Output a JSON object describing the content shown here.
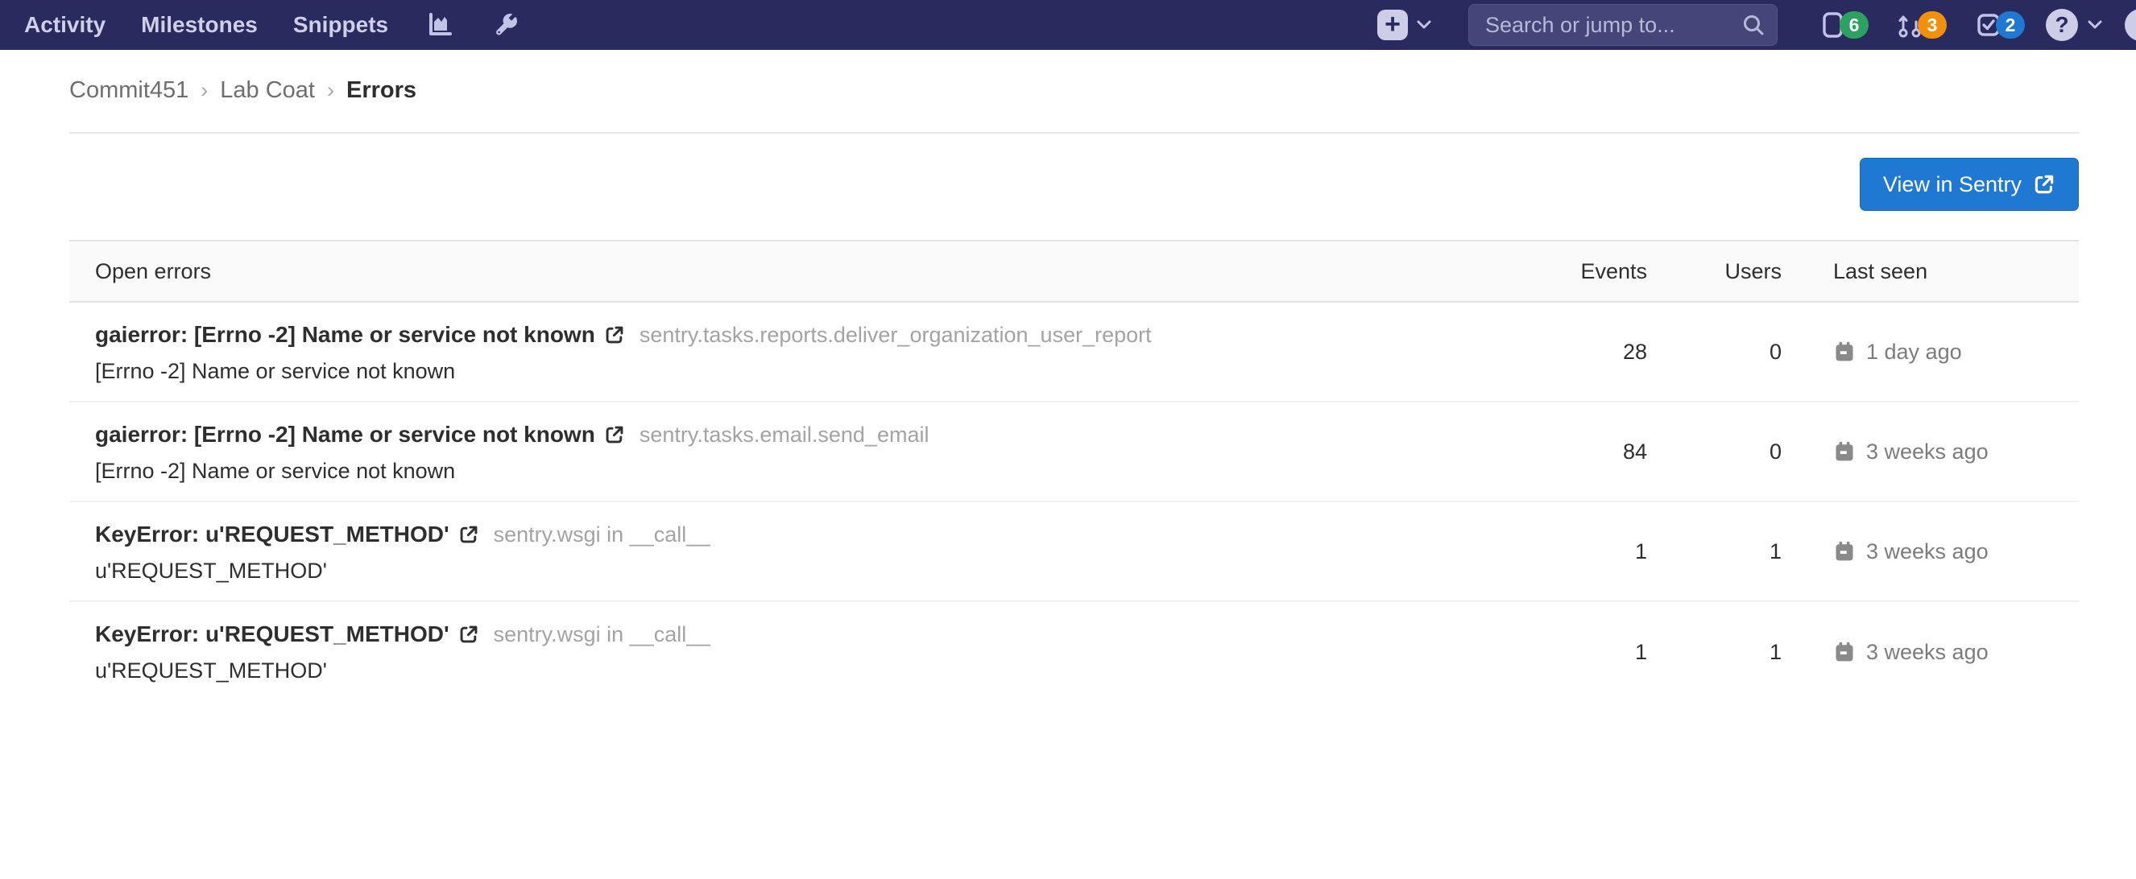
{
  "colors": {
    "navbar_bg": "#292a5e",
    "accent_blue": "#1f78d1",
    "badge_green": "#2da160",
    "badge_orange": "#f2900e",
    "badge_blue": "#1f78d1"
  },
  "navbar": {
    "links": [
      "Activity",
      "Milestones",
      "Snippets"
    ],
    "nav_icons": [
      "area-chart-icon",
      "wrench-icon"
    ],
    "plus_glyph": "+",
    "search_placeholder": "Search or jump to...",
    "counters": [
      {
        "name": "issues",
        "icon": "issues-icon",
        "count": "6",
        "color": "#2da160"
      },
      {
        "name": "merge_requests",
        "icon": "merge-request-icon",
        "count": "3",
        "color": "#f2900e"
      },
      {
        "name": "todos",
        "icon": "todo-check-icon",
        "count": "2",
        "color": "#1f78d1"
      }
    ],
    "help_glyph": "?"
  },
  "breadcrumb": {
    "separator": "›",
    "items": [
      "Commit451",
      "Lab Coat",
      "Errors"
    ]
  },
  "sentry": {
    "view_button_label": "View in Sentry"
  },
  "error_table": {
    "title": "Open errors",
    "columns": [
      "Events",
      "Users",
      "Last seen"
    ],
    "rows": [
      {
        "title": "gaierror: [Errno -2] Name or service not known",
        "culprit": "sentry.tasks.reports.deliver_organization_user_report",
        "message": "[Errno -2] Name or service not known",
        "events": "28",
        "users": "0",
        "last_seen": "1 day ago"
      },
      {
        "title": "gaierror: [Errno -2] Name or service not known",
        "culprit": "sentry.tasks.email.send_email",
        "message": "[Errno -2] Name or service not known",
        "events": "84",
        "users": "0",
        "last_seen": "3 weeks ago"
      },
      {
        "title": "KeyError: u'REQUEST_METHOD'",
        "culprit": "sentry.wsgi in __call__",
        "message": "u'REQUEST_METHOD'",
        "events": "1",
        "users": "1",
        "last_seen": "3 weeks ago"
      },
      {
        "title": "KeyError: u'REQUEST_METHOD'",
        "culprit": "sentry.wsgi in __call__",
        "message": "u'REQUEST_METHOD'",
        "events": "1",
        "users": "1",
        "last_seen": "3 weeks ago"
      }
    ]
  }
}
